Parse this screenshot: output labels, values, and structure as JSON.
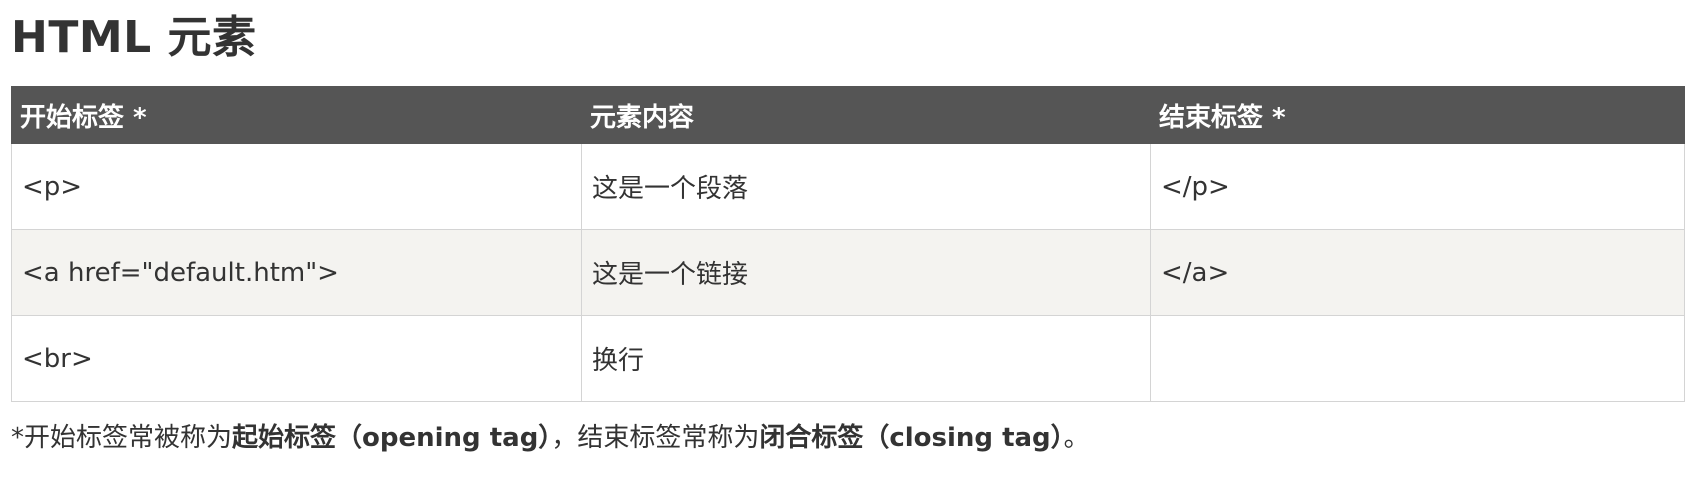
{
  "title": "HTML 元素",
  "table": {
    "headers": [
      "开始标签 *",
      "元素内容",
      "结束标签 *"
    ],
    "rows": [
      [
        "<p>",
        "这是一个段落",
        "</p>"
      ],
      [
        "<a href=\"default.htm\">",
        "这是一个链接",
        "</a>"
      ],
      [
        "<br>",
        "换行",
        ""
      ]
    ]
  },
  "footnote": {
    "part1": "*开始标签常被称为",
    "bold1": "起始标签（opening tag）",
    "part2": "，结束标签常称为",
    "bold2": "闭合标签（closing tag）",
    "part3": "。"
  },
  "colors": {
    "header_bg": "#555555",
    "alt_row_bg": "#f4f3f0",
    "border": "#d4d4d4",
    "text": "#333333"
  }
}
